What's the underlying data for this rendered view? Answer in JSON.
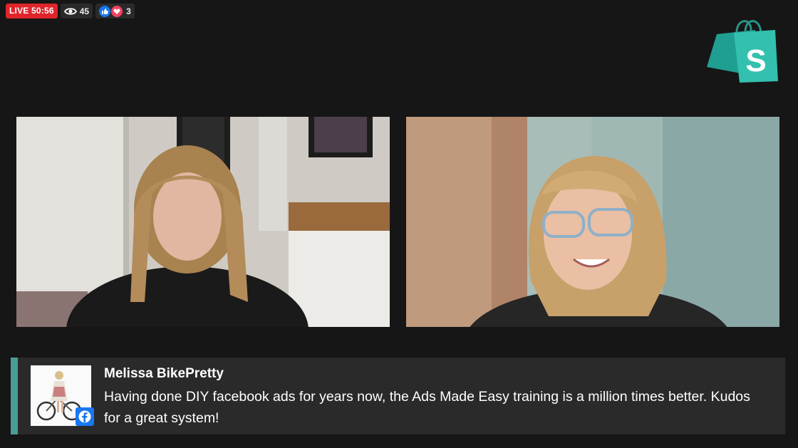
{
  "status": {
    "live_label": "LIVE 50:56",
    "viewer_count": "45",
    "reaction_count": "3",
    "icons": [
      "eye-icon",
      "like-icon",
      "love-icon"
    ]
  },
  "branding": {
    "logo": "shopify-bag-logo",
    "logo_letter": "S",
    "colors": {
      "logo": "#2fb8a8",
      "live": "#e0242b",
      "accent": "#4a9d96"
    }
  },
  "panels": [
    {
      "name": "host-video"
    },
    {
      "name": "guest-video"
    }
  ],
  "comment": {
    "author": "Melissa BikePretty",
    "text": "Having done DIY facebook ads for years now, the Ads Made Easy training is a million times better. Kudos for a great system!",
    "source_icon": "facebook-icon"
  }
}
